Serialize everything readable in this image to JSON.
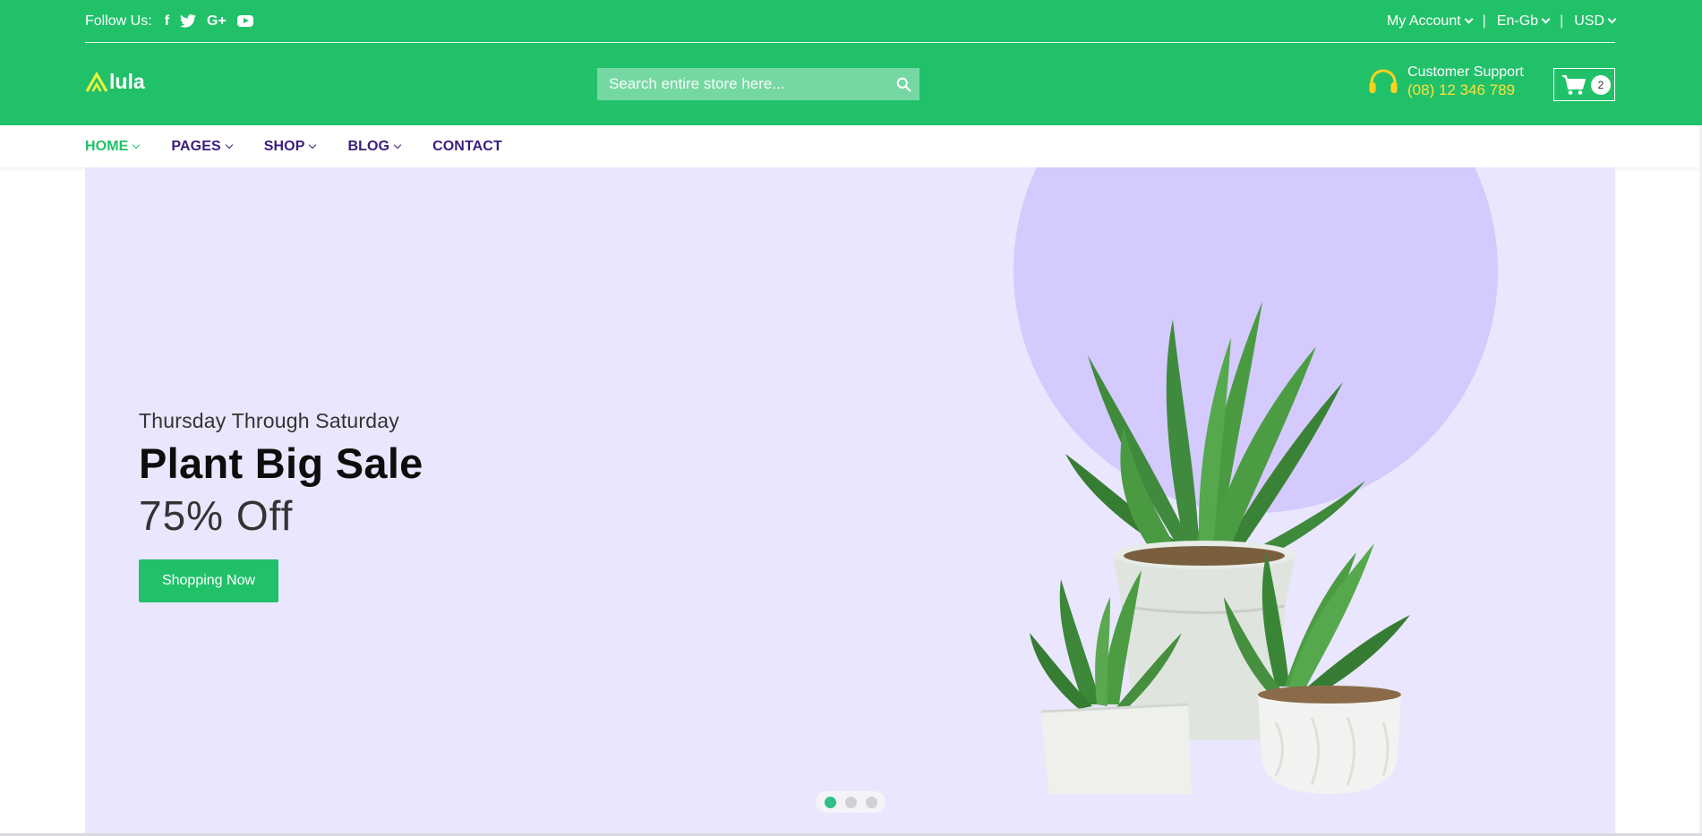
{
  "topbar": {
    "follow_label": "Follow Us:",
    "social": [
      {
        "icon": "facebook-icon",
        "glyph": "f"
      },
      {
        "icon": "twitter-icon",
        "glyph": ""
      },
      {
        "icon": "google-plus-icon",
        "glyph": "G+"
      },
      {
        "icon": "youtube-icon",
        "glyph": ""
      }
    ],
    "account_label": "My Account",
    "language_label": "En-Gb",
    "currency_label": "USD",
    "separator": "|"
  },
  "header": {
    "logo_text": "lula",
    "search_placeholder": "Search entire store here...",
    "support_label": "Customer Support",
    "support_phone": "(08) 12 346 789",
    "cart_count": "2"
  },
  "nav": {
    "items": [
      {
        "label": "HOME",
        "dropdown": true
      },
      {
        "label": "PAGES",
        "dropdown": true
      },
      {
        "label": "SHOP",
        "dropdown": true
      },
      {
        "label": "BLOG",
        "dropdown": true
      },
      {
        "label": "CONTACT",
        "dropdown": false
      }
    ],
    "active": "HOME"
  },
  "hero": {
    "eyebrow": "Thursday Through Saturday",
    "headline": "Plant Big Sale",
    "discount": "75% Off",
    "cta_label": "Shopping Now",
    "slides": 3,
    "active_slide": 1
  },
  "colors": {
    "brand_green": "#21c16a",
    "accent_yellow": "#ffe03a",
    "nav_purple": "#3b1d7a",
    "hero_bg": "#e9e6fd",
    "hero_circle": "#d4cafd"
  }
}
